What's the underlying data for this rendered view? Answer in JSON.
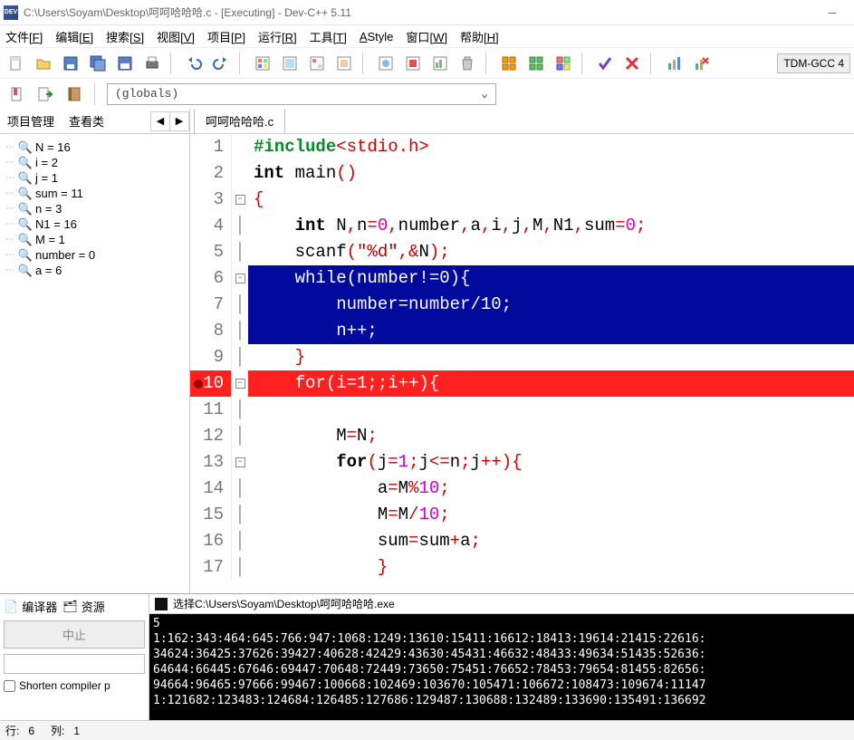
{
  "window": {
    "title": "C:\\Users\\Soyam\\Desktop\\呵呵哈哈哈.c - [Executing] - Dev-C++ 5.11"
  },
  "menu": [
    {
      "label": "文件",
      "accel": "F"
    },
    {
      "label": "编辑",
      "accel": "E"
    },
    {
      "label": "搜索",
      "accel": "S"
    },
    {
      "label": "视图",
      "accel": "V"
    },
    {
      "label": "项目",
      "accel": "P"
    },
    {
      "label": "运行",
      "accel": "R"
    },
    {
      "label": "工具",
      "accel": "T"
    },
    {
      "label": "AStyle",
      "accel": ""
    },
    {
      "label": "窗口",
      "accel": "W"
    },
    {
      "label": "帮助",
      "accel": "H"
    }
  ],
  "compiler_selector": "TDM-GCC 4",
  "globals_dropdown": "(globals)",
  "sidebar": {
    "tab_project": "项目管理",
    "tab_classes": "查看类",
    "vars": [
      {
        "name": "N",
        "value": "16"
      },
      {
        "name": "i",
        "value": "2"
      },
      {
        "name": "j",
        "value": "1"
      },
      {
        "name": "sum",
        "value": "11"
      },
      {
        "name": "n",
        "value": "3"
      },
      {
        "name": "N1",
        "value": "16"
      },
      {
        "name": "M",
        "value": "1"
      },
      {
        "name": "number",
        "value": "0"
      },
      {
        "name": "a",
        "value": "6"
      }
    ]
  },
  "file_tab": "呵呵哈哈哈.c",
  "code": {
    "l1_pp": "#include",
    "l1_hdr": "<stdio.h>",
    "l2_a": "int",
    "l2_b": " main",
    "l2_c": "()",
    "l3": "{",
    "l4_a": "    ",
    "l4_kw": "int",
    "l4_rest1": " N",
    "l4_c1": ",",
    "l4_rest2": "n",
    "l4_eq1": "=",
    "l4_num0": "0",
    "l4_c2": ",",
    "l4_rest3": "number",
    "l4_c3": ",",
    "l4_rest4": "a",
    "l4_c4": ",",
    "l4_rest5": "i",
    "l4_c5": ",",
    "l4_rest6": "j",
    "l4_c6": ",",
    "l4_rest7": "M",
    "l4_c7": ",",
    "l4_rest8": "N1",
    "l4_c8": ",",
    "l4_rest9": "sum",
    "l4_eq2": "=",
    "l4_num1": "0",
    "l4_semi": ";",
    "l5_a": "    scanf",
    "l5_p1": "(",
    "l5_str": "\"%d\"",
    "l5_c": ",",
    "l5_amp": "&",
    "l5_n": "N",
    "l5_p2": ")",
    "l5_semi": ";",
    "l6": "    while(number!=0){",
    "l7": "        number=number/10;",
    "l8": "        n++;",
    "l9_a": "    ",
    "l9_b": "}",
    "l10": "    for(i=1;;i++){",
    "l11": "",
    "l12_a": "        M",
    "l12_eq": "=",
    "l12_b": "N",
    "l12_semi": ";",
    "l13_a": "        ",
    "l13_kw": "for",
    "l13_p1": "(",
    "l13_b": "j",
    "l13_eq": "=",
    "l13_n1": "1",
    "l13_semi1": ";",
    "l13_c": "j",
    "l13_le": "<=",
    "l13_d": "n",
    "l13_semi2": ";",
    "l13_e": "j",
    "l13_pp": "++",
    "l13_p2": ")",
    "l13_br": "{",
    "l14_a": "            a",
    "l14_eq": "=",
    "l14_b": "M",
    "l14_mod": "%",
    "l14_n": "10",
    "l14_semi": ";",
    "l15_a": "            M",
    "l15_eq": "=",
    "l15_b": "M",
    "l15_div": "/",
    "l15_n": "10",
    "l15_semi": ";",
    "l16_a": "            sum",
    "l16_eq": "=",
    "l16_b": "sum",
    "l16_plus": "+",
    "l16_c": "a",
    "l16_semi": ";",
    "l17": "            }"
  },
  "bottom": {
    "tab_compiler": "编译器",
    "tab_resource": "资源",
    "btn_abort": "中止",
    "chk_shorten": "Shorten compiler p"
  },
  "console": {
    "title": "选择C:\\Users\\Soyam\\Desktop\\呵呵哈哈哈.exe",
    "lines": [
      "5",
      "1:162:343:464:645:766:947:1068:1249:13610:15411:16612:18413:19614:21415:22616:",
      "34624:36425:37626:39427:40628:42429:43630:45431:46632:48433:49634:51435:52636:",
      "64644:66445:67646:69447:70648:72449:73650:75451:76652:78453:79654:81455:82656:",
      "94664:96465:97666:99467:100668:102469:103670:105471:106672:108473:109674:11147",
      "1:121682:123483:124684:126485:127686:129487:130688:132489:133690:135491:136692"
    ]
  },
  "status": {
    "line_label": "行:",
    "line_val": "6",
    "col_label": "列:",
    "col_val": "1"
  }
}
